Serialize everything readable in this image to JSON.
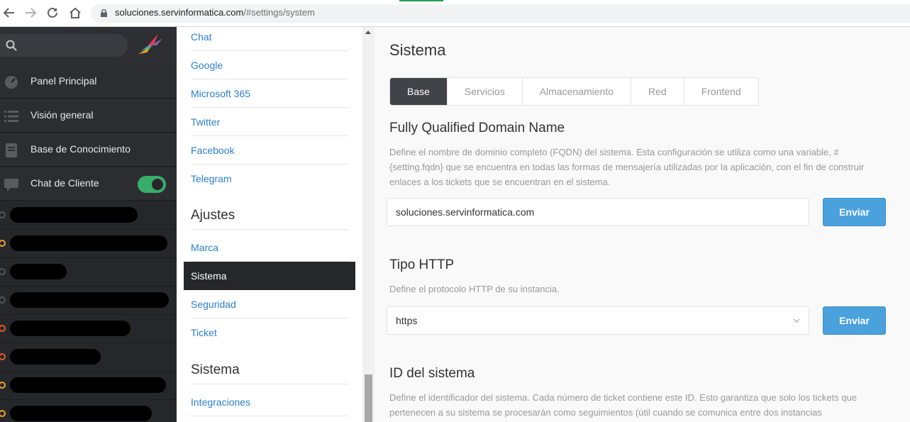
{
  "browser": {
    "url_host": "soluciones.servinformatica.com",
    "url_path": "/#settings/system"
  },
  "nav": {
    "items": [
      {
        "label": "Panel Principal",
        "icon": "dashboard-icon"
      },
      {
        "label": "Visión general",
        "icon": "list-icon"
      },
      {
        "label": "Base de Conocimiento",
        "icon": "book-icon"
      },
      {
        "label": "Chat de Cliente",
        "icon": "chat-icon"
      }
    ],
    "chat_toggle_on": true
  },
  "submenu": {
    "channel_links": [
      "Chat",
      "Google",
      "Microsoft 365",
      "Twitter",
      "Facebook",
      "Telegram"
    ],
    "ajustes_heading": "Ajustes",
    "ajustes_links": [
      "Marca",
      "Sistema",
      "Seguridad",
      "Ticket"
    ],
    "sistema_heading": "Sistema",
    "sistema_links": [
      "Integraciones"
    ]
  },
  "content": {
    "title": "Sistema",
    "tabs": [
      "Base",
      "Servicios",
      "Almacenamiento",
      "Red",
      "Frontend"
    ],
    "fqdn": {
      "title": "Fully Qualified Domain Name",
      "desc": "Define el nombre de dominio completo (FQDN) del sistema. Esta configuración se utiliza como una variable, #{setting.fqdn} que se encuentra en todas las formas de mensajería utilizadas por la aplicación, con el fin de construir enlaces a los tickets que se encuentran en el sistema.",
      "value": "soluciones.servinformatica.com",
      "button": "Enviar"
    },
    "http": {
      "title": "Tipo HTTP",
      "desc": "Define el protocolo HTTP de su instancia.",
      "value": "https",
      "button": "Enviar"
    },
    "system_id": {
      "title": "ID del sistema",
      "desc": "Define el identificador del sistema. Cada número de ticket contiene este ID. Esto garantiza que solo los tickets que pertenecen a su sistema se procesarán como seguimientos (útil cuando se comunica entre dos instancias"
    }
  }
}
